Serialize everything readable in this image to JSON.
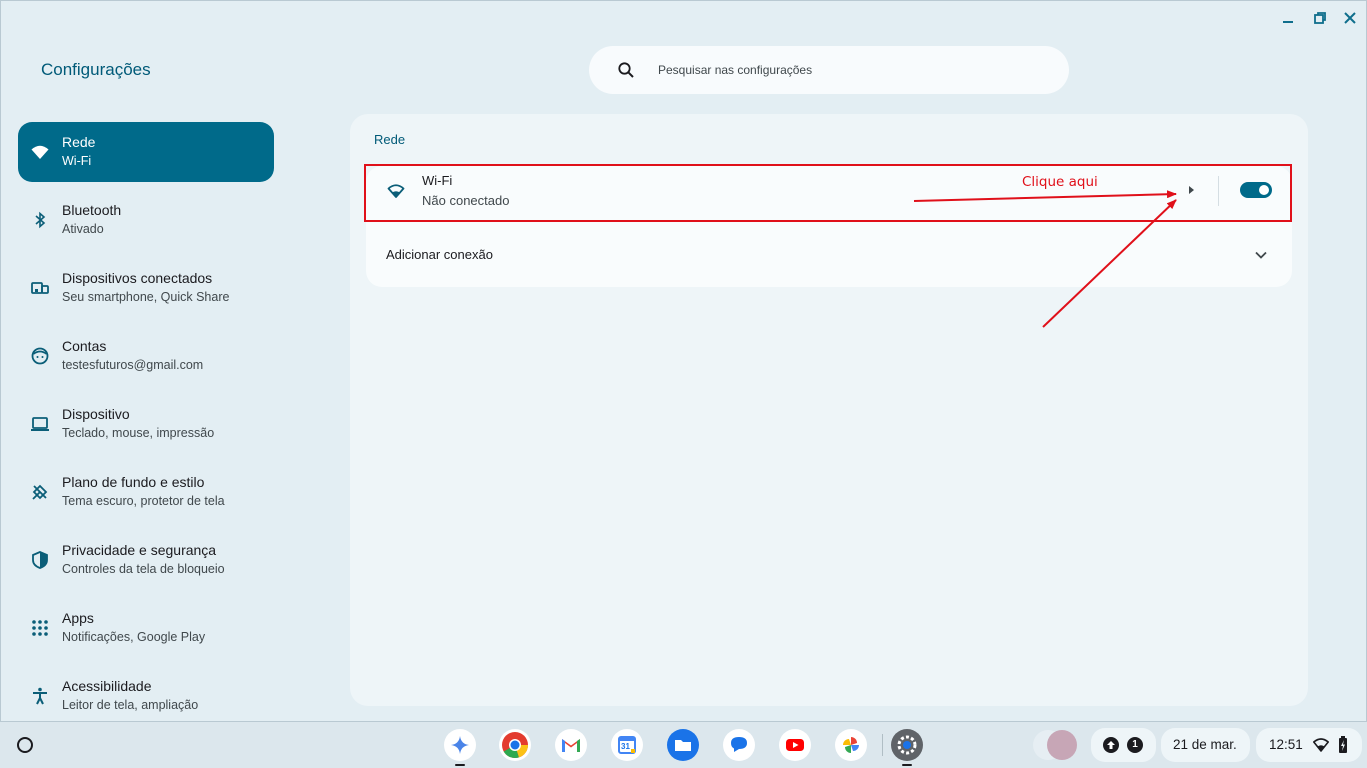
{
  "window": {
    "title": "Configurações",
    "controls": [
      "minimize-icon",
      "restore-icon",
      "close-icon"
    ]
  },
  "search": {
    "placeholder": "Pesquisar nas configurações",
    "icon": "search-icon"
  },
  "sidebar": {
    "items": [
      {
        "label": "Rede",
        "sublabel": "Wi-Fi",
        "icon": "wifi-icon",
        "active": true
      },
      {
        "label": "Bluetooth",
        "sublabel": "Ativado",
        "icon": "bluetooth-icon"
      },
      {
        "label": "Dispositivos conectados",
        "sublabel": "Seu smartphone, Quick Share",
        "icon": "connected-devices-icon"
      },
      {
        "label": "Contas",
        "sublabel": "testesfuturos@gmail.com",
        "icon": "account-icon"
      },
      {
        "label": "Dispositivo",
        "sublabel": "Teclado, mouse, impressão",
        "icon": "laptop-icon"
      },
      {
        "label": "Plano de fundo e estilo",
        "sublabel": "Tema escuro, protetor de tela",
        "icon": "palette-brush-icon"
      },
      {
        "label": "Privacidade e segurança",
        "sublabel": "Controles da tela de bloqueio",
        "icon": "shield-icon"
      },
      {
        "label": "Apps",
        "sublabel": "Notificações, Google Play",
        "icon": "apps-grid-icon"
      },
      {
        "label": "Acessibilidade",
        "sublabel": "Leitor de tela, ampliação",
        "icon": "accessibility-icon"
      }
    ]
  },
  "main": {
    "section_title": "Rede",
    "wifi": {
      "label": "Wi-Fi",
      "status": "Não conectado",
      "toggle_on": true
    },
    "add_connection": {
      "label": "Adicionar conexão"
    }
  },
  "annotation": {
    "text": "Clique aqui",
    "color": "#e0101a"
  },
  "shelf": {
    "apps": [
      "gemini-icon",
      "chrome-icon",
      "gmail-icon",
      "calendar-icon",
      "files-icon",
      "messages-icon",
      "youtube-icon",
      "photos-icon",
      "settings-icon"
    ],
    "calendar_day": "31",
    "notification_count": "1",
    "date": "21 de mar.",
    "time": "12:51"
  },
  "colors": {
    "accent": "#006a8a",
    "background": "#e3eef3",
    "panel": "#eef5f8"
  }
}
